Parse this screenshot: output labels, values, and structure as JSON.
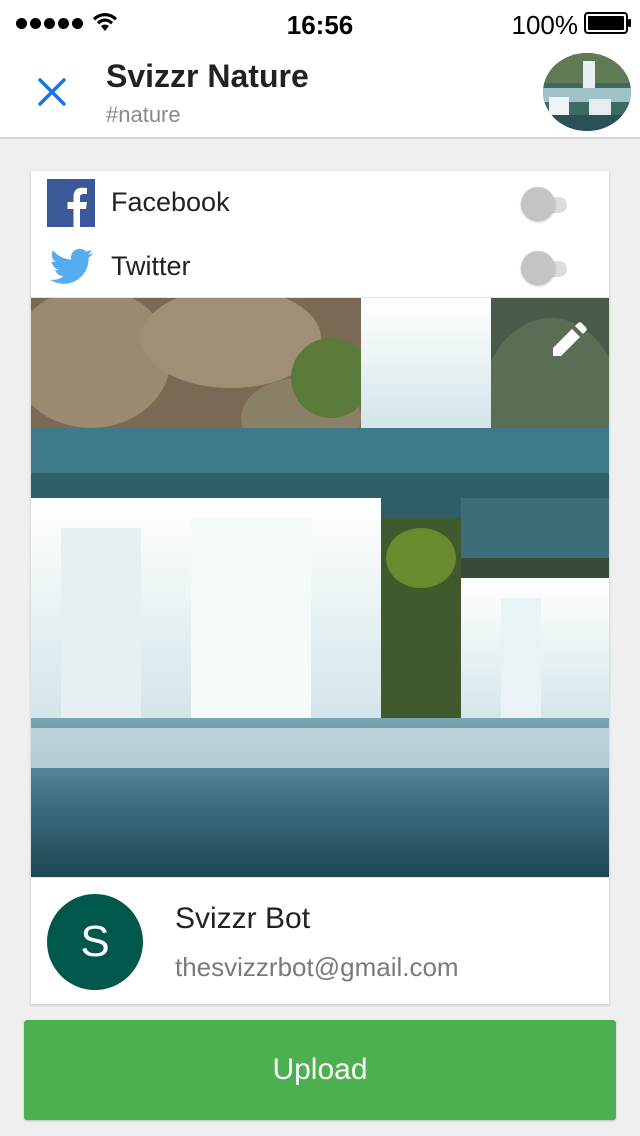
{
  "status_bar": {
    "time": "16:56",
    "battery_percent": "100%",
    "signal_icon": "signal-dots-icon",
    "wifi_icon": "wifi-icon",
    "battery_icon": "battery-icon"
  },
  "header": {
    "title": "Svizzr Nature",
    "subtitle": "#nature",
    "close_icon": "close-icon",
    "accent_color": "#1a73e8"
  },
  "share": {
    "items": [
      {
        "label": "Facebook",
        "icon": "facebook-icon",
        "enabled": false,
        "color": "#3b5998"
      },
      {
        "label": "Twitter",
        "icon": "twitter-icon",
        "enabled": false,
        "color": "#55acee"
      }
    ]
  },
  "photo": {
    "edit_icon": "pencil-icon"
  },
  "author": {
    "initial": "S",
    "name": "Svizzr Bot",
    "email": "thesvizzrbot@gmail.com",
    "avatar_color": "#00574b"
  },
  "actions": {
    "upload_label": "Upload",
    "upload_color": "#4caf50"
  }
}
